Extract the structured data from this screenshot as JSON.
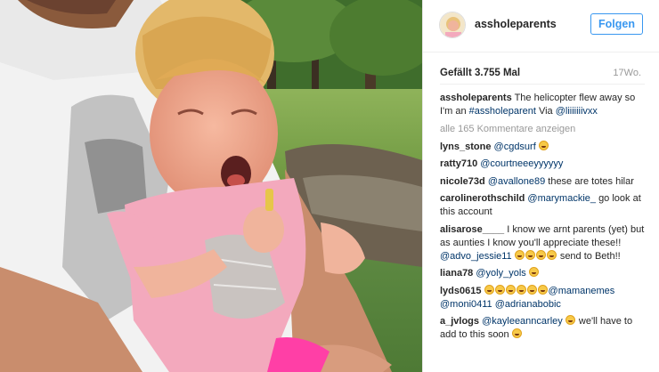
{
  "post": {
    "username": "assholeparents",
    "follow_label": "Folgen",
    "likes": "Gefällt 3.755 Mal",
    "time_ago": "17Wo."
  },
  "caption": {
    "username": "assholeparents",
    "text_1": "The helicopter flew away so I'm an ",
    "hashtag": "#assholeparent",
    "text_2": " Via ",
    "via": "@liiiiiiivxx"
  },
  "load_more": "alle 165 Kommentare anzeigen",
  "comments": [
    {
      "user": "lyns_stone",
      "mention": "@cgdsurf",
      "emoji_count": 1
    },
    {
      "user": "ratty710",
      "mention": "@courtneeeyyyyyy"
    },
    {
      "user": "nicole73d",
      "mention": "@avallone89",
      "text": "these are totes hilar"
    },
    {
      "user": "carolinerothschild",
      "mention": "@marymackie_",
      "text": "go look at this account"
    },
    {
      "user": "alisarose____",
      "text_1": "I know we arnt parents (yet) but as aunties I know you'll appreciate these!! ",
      "mention": "@advo_jessie11",
      "emoji_count": 4,
      "text_2": "send to Beth!!"
    },
    {
      "user": "liana78",
      "mention": "@yoly_yols",
      "emoji_count": 1
    },
    {
      "user": "lyds0615",
      "emoji_count": 6,
      "mention": "@mamanemes",
      "mention_2": "@moni0411",
      "mention_3": "@adrianabobic"
    },
    {
      "user": "a_jvlogs",
      "mention": "@kayleeanncarley",
      "emoji_count": 1,
      "text": "we'll have to add to this soon",
      "emoji_count_2": 1
    }
  ],
  "icons": {
    "avatar": "profile-picture",
    "emoji": "tears-of-joy-emoji"
  },
  "colors": {
    "accent": "#3897f0",
    "link": "#003569",
    "text": "#262626",
    "muted": "#999999"
  }
}
